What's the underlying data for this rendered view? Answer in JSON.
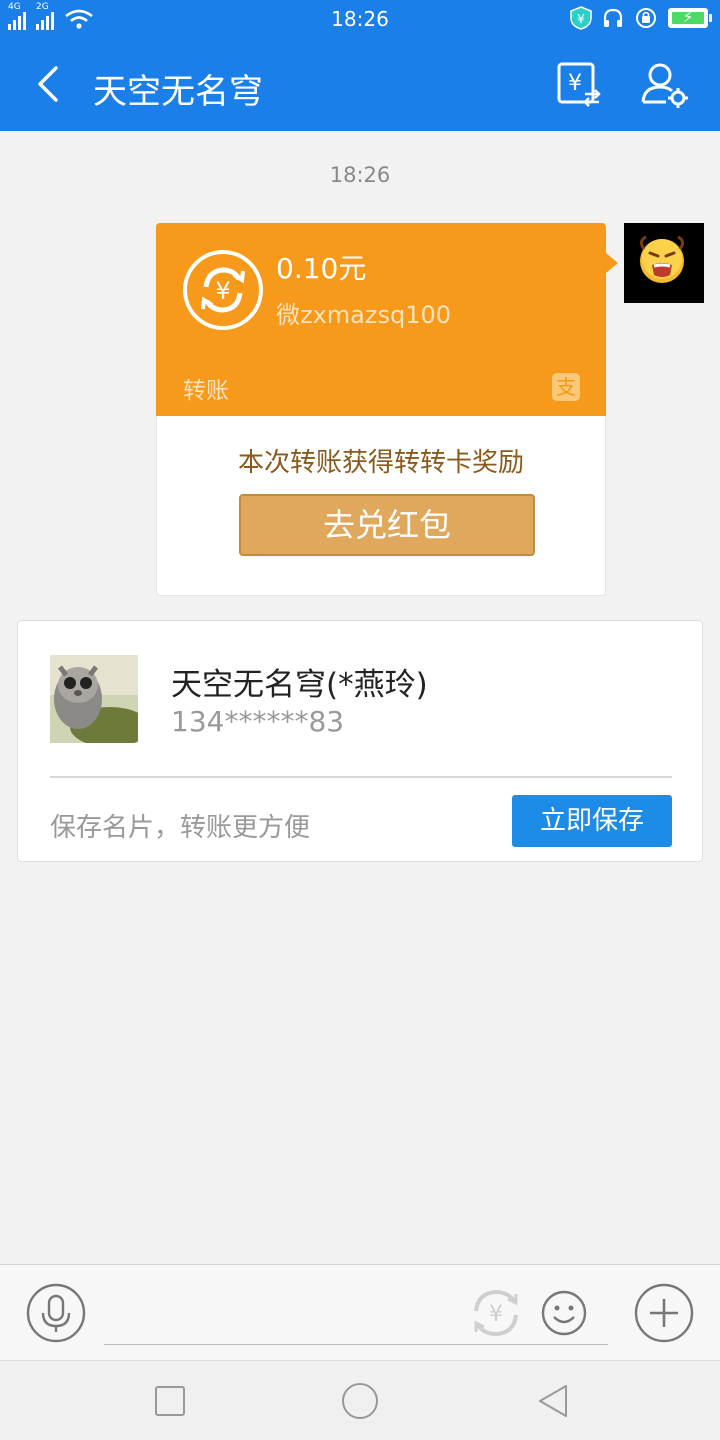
{
  "status_bar": {
    "network_1": "4G",
    "network_2": "2G",
    "time": "18:26"
  },
  "navbar": {
    "title": "天空无名穹"
  },
  "chat": {
    "timestamp": "18:26",
    "transfer": {
      "amount": "0.10元",
      "memo": "微zxmazsq100",
      "type_label": "转账",
      "reward_text": "本次转账获得转转卡奖励",
      "redeem_button": "去兑红包"
    }
  },
  "contact_card": {
    "name": "天空无名穹(*燕玲)",
    "phone": "134******83",
    "hint": "保存名片，转账更方便",
    "save_button": "立即保存"
  },
  "input_bar": {
    "placeholder": ""
  },
  "colors": {
    "brand_blue": "#1a7fe8",
    "transfer_orange": "#f7991a",
    "redeem_gold": "#dfa85c",
    "save_blue": "#1d8ce6"
  }
}
